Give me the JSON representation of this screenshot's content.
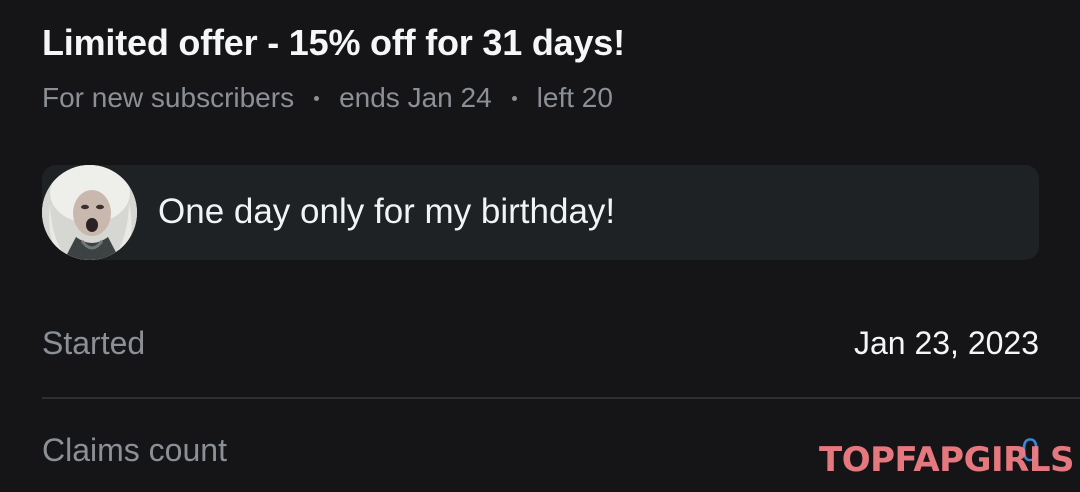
{
  "offer": {
    "title": "Limited offer - 15% off for 31 days!",
    "audience": "For new subscribers",
    "ends": "ends Jan 24",
    "left": "left 20"
  },
  "message": {
    "text": "One day only for my birthday!"
  },
  "details": {
    "started_label": "Started",
    "started_value": "Jan 23, 2023",
    "claims_label": "Claims count",
    "claims_value": "0"
  },
  "watermark": {
    "text": "TOPFAPGIRLS"
  },
  "colors": {
    "background": "#151517",
    "message_bubble": "#1f2224",
    "muted_text": "#8a9096",
    "watermark": "#f17d85"
  }
}
